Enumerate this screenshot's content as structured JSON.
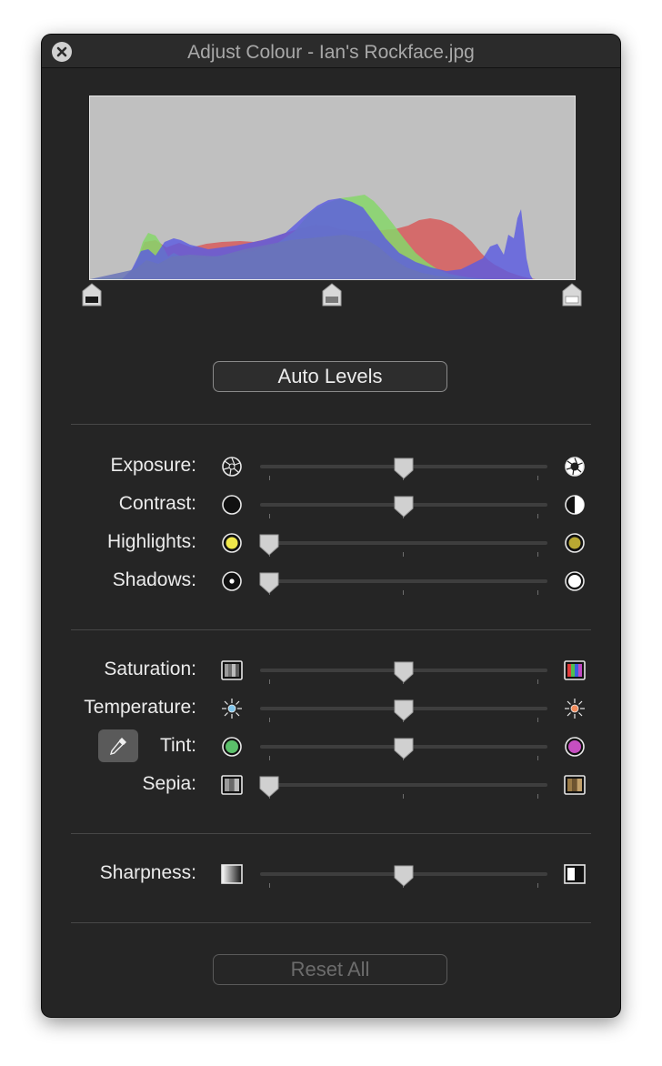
{
  "window": {
    "title": "Adjust Colour - Ian's Rockface.jpg"
  },
  "histogram": {
    "levels": {
      "black": 0.0,
      "mid": 0.5,
      "white": 1.0
    },
    "channel_colors": {
      "red": "#d65f5f",
      "green": "#86d66a",
      "blue": "#5c5ce0"
    }
  },
  "buttons": {
    "auto_levels": "Auto Levels",
    "reset_all": "Reset All"
  },
  "sliders": [
    {
      "id": "exposure",
      "label": "Exposure:",
      "value": 0.5,
      "left_icon": "aperture-closed-icon",
      "right_icon": "aperture-open-icon"
    },
    {
      "id": "contrast",
      "label": "Contrast:",
      "value": 0.5,
      "left_icon": "contrast-low-icon",
      "right_icon": "contrast-high-icon"
    },
    {
      "id": "highlights",
      "label": "Highlights:",
      "value": 0.0,
      "left_icon": "highlights-bright-icon",
      "right_icon": "highlights-dim-icon"
    },
    {
      "id": "shadows",
      "label": "Shadows:",
      "value": 0.0,
      "left_icon": "shadows-dark-icon",
      "right_icon": "shadows-light-icon"
    },
    {
      "id": "saturation",
      "label": "Saturation:",
      "value": 0.5,
      "left_icon": "desaturated-icon",
      "right_icon": "saturated-icon"
    },
    {
      "id": "temperature",
      "label": "Temperature:",
      "value": 0.5,
      "left_icon": "cool-sun-icon",
      "right_icon": "warm-sun-icon"
    },
    {
      "id": "tint",
      "label": "Tint:",
      "value": 0.5,
      "left_icon": "green-tint-icon",
      "right_icon": "magenta-tint-icon"
    },
    {
      "id": "sepia",
      "label": "Sepia:",
      "value": 0.0,
      "left_icon": "no-sepia-icon",
      "right_icon": "sepia-icon"
    },
    {
      "id": "sharpness",
      "label": "Sharpness:",
      "value": 0.5,
      "left_icon": "soft-edge-icon",
      "right_icon": "sharp-edge-icon"
    }
  ],
  "colors": {
    "window_bg": "#252525",
    "text": "#ececec",
    "title_text": "#a8a8a8",
    "disabled_text": "#6c6c6c",
    "highlight_yellow": "#f0e84a",
    "highlight_olive": "#b8a832",
    "tint_green": "#5bbf6a",
    "tint_magenta": "#c64fc0",
    "sepia_brown": "#9a7a46"
  }
}
